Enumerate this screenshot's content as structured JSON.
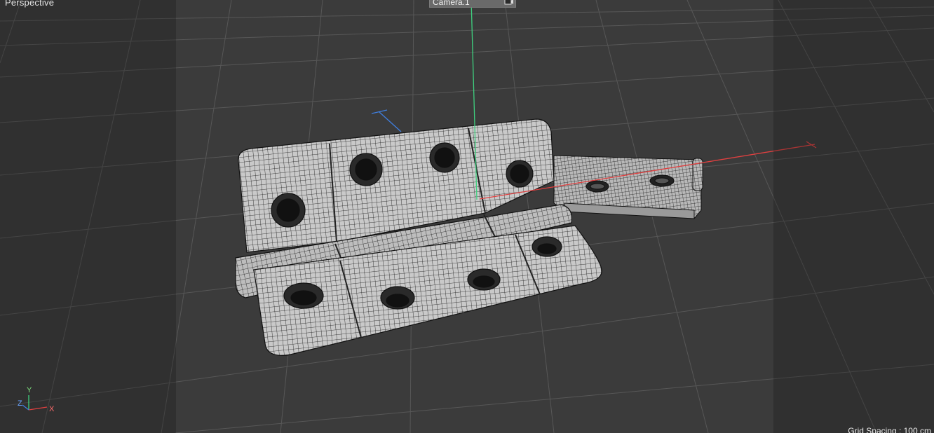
{
  "viewport": {
    "view_name": "Perspective",
    "camera_name": "Camera.1",
    "grid_spacing": "Grid Spacing : 100 cm",
    "axes": {
      "x": "X",
      "y": "Y",
      "z": "Z"
    }
  },
  "icons": {
    "camera": "camera-options-icon"
  },
  "colors": {
    "background": "#3b3b3b",
    "grid_line": "#555555",
    "mesh_fill": "#c9c9c9",
    "wire": "#1a1a1a",
    "x_axis": "#e04040",
    "y_axis": "#3fd07f",
    "z_axis": "#3f7fe0"
  }
}
